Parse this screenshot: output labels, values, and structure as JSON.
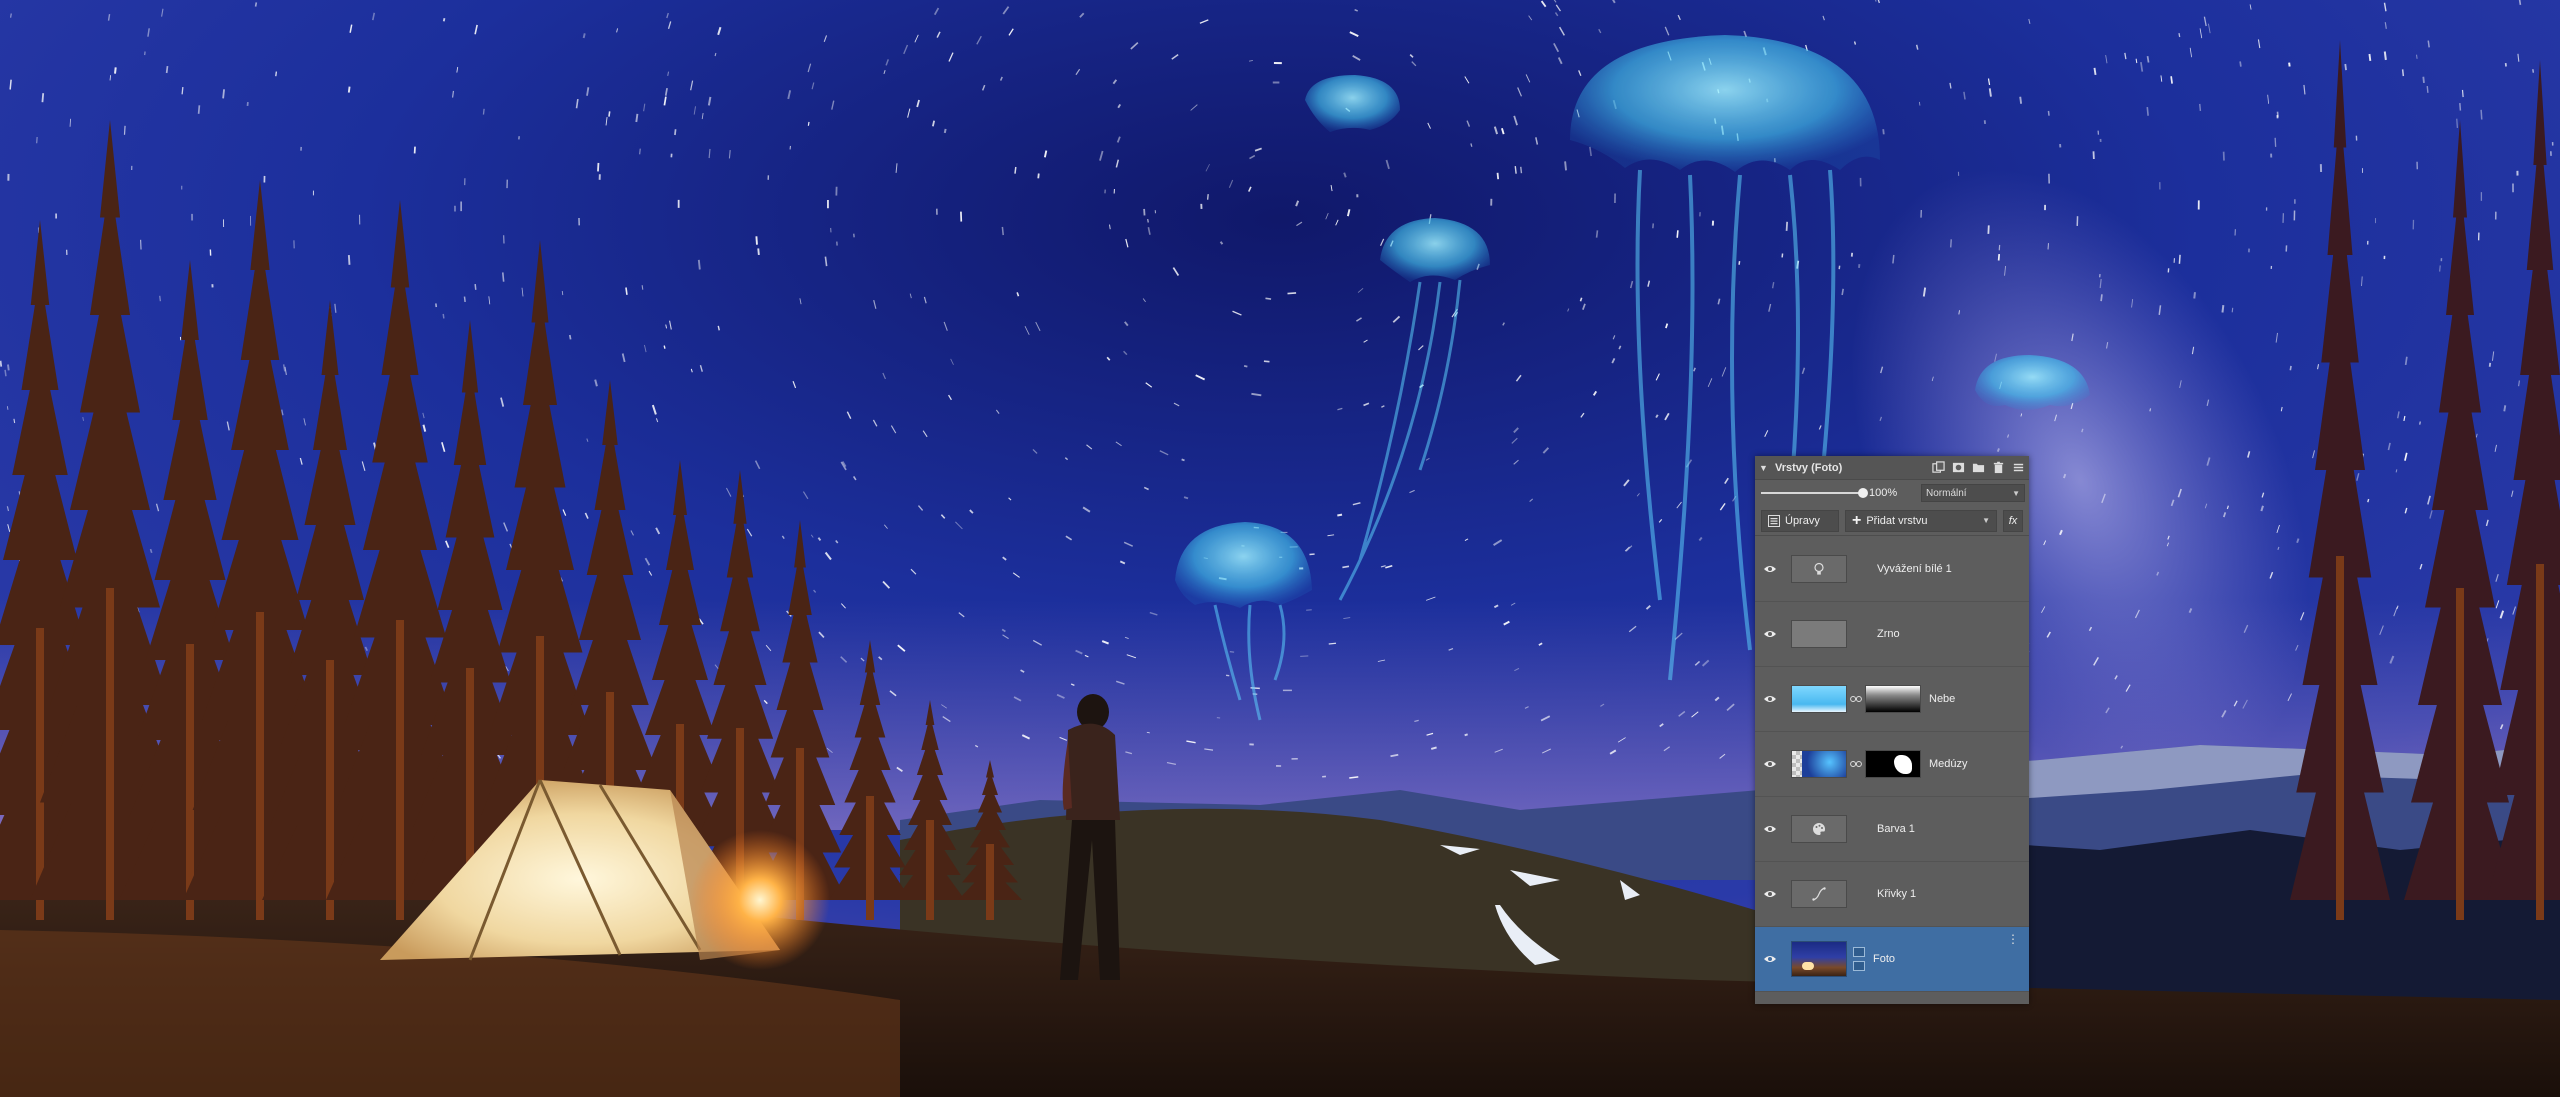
{
  "panel": {
    "title": "Vrstvy (Foto)",
    "opacity": {
      "value": 100,
      "label": "100%"
    },
    "blend_mode": "Normální",
    "adjust_button": "Úpravy",
    "add_layer_button": "Přidat vrstvu",
    "fx_button": "fx",
    "header_icons": [
      "duplicate-icon",
      "mask-icon",
      "folder-icon",
      "delete-icon",
      "menu-icon"
    ]
  },
  "layers": [
    {
      "name": "Vyvážení bílé 1",
      "kind": "adjustment",
      "thumb_icon": "bulb-icon",
      "visible": true,
      "selected": false
    },
    {
      "name": "Zrno",
      "kind": "plain",
      "visible": true,
      "selected": false
    },
    {
      "name": "Nebe",
      "kind": "masked",
      "visible": true,
      "selected": false
    },
    {
      "name": "Medúzy",
      "kind": "masked",
      "visible": true,
      "selected": false
    },
    {
      "name": "Barva 1",
      "kind": "adjustment",
      "thumb_icon": "palette-icon",
      "visible": true,
      "selected": false
    },
    {
      "name": "Křivky 1",
      "kind": "adjustment",
      "thumb_icon": "curves-icon",
      "visible": true,
      "selected": false
    },
    {
      "name": "Foto",
      "kind": "photo",
      "visible": true,
      "selected": true
    }
  ],
  "colors": {
    "panel_bg": "#5d5d5d",
    "selected_row": "#3f6ea3",
    "sky": "#1a2a8a",
    "jellyfish": "#4fd6ff"
  }
}
